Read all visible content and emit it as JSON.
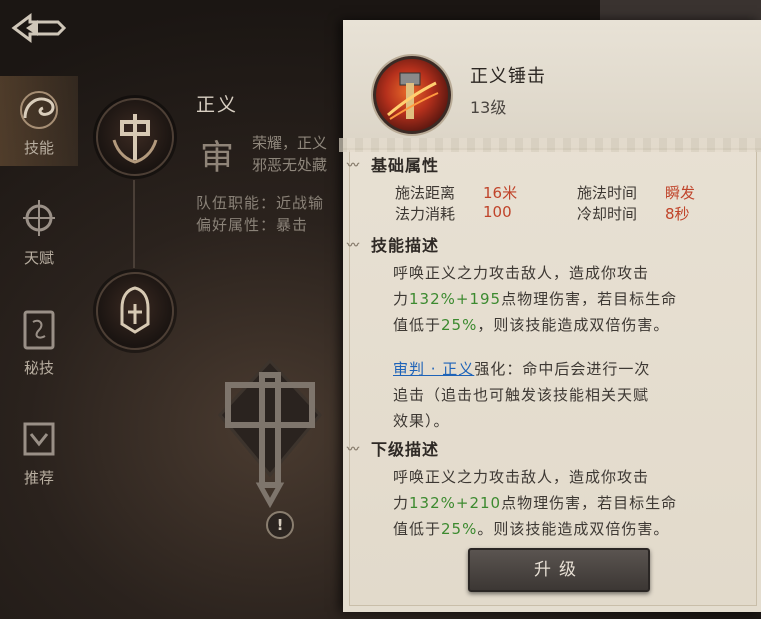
{
  "sidebar": {
    "items": [
      {
        "label": "技能",
        "icon": "skill-icon",
        "active": true
      },
      {
        "label": "天赋",
        "icon": "talent-icon",
        "active": false
      },
      {
        "label": "秘技",
        "icon": "secret-art-icon",
        "active": false
      },
      {
        "label": "推荐",
        "icon": "recommend-icon",
        "active": false
      }
    ]
  },
  "hero": {
    "name": "正义",
    "title_char": "审",
    "desc_line1": "荣耀，正义",
    "desc_line2": "邪恶无处藏",
    "role_line": "队伍职能：近战输",
    "pref_line": "偏好属性：暴击",
    "alert": "!"
  },
  "popup": {
    "skill_name": "正义锤击",
    "skill_level": "13级",
    "basic_title": "基础属性",
    "attrs": {
      "range_label": "施法距离",
      "range_value": "16米",
      "cast_label": "施法时间",
      "cast_value": "瞬发",
      "cost_label": "法力消耗",
      "cost_value": "100",
      "cd_label": "冷却时间",
      "cd_value": "8秒"
    },
    "desc_title": "技能描述",
    "desc": {
      "l1": "呼唤正义之力攻击敌人，造成你攻击",
      "l2_a": "力",
      "l2_b": "132%+195",
      "l2_c": "点物理伤害，若目标生命",
      "l3_a": "值低于",
      "l3_b": "25%",
      "l3_c": "，则该技能造成双倍伤害。"
    },
    "enhance": {
      "link": "审判 · 正义",
      "t1": "强化：命中后会进行一次",
      "t2": "追击（追击也可触发该技能相关天赋",
      "t3": "效果）。"
    },
    "next_title": "下级描述",
    "next": {
      "l1": "呼唤正义之力攻击敌人，造成你攻击",
      "l2_a": "力",
      "l2_b": "132%+210",
      "l2_c": "点物理伤害，若目标生命",
      "l3_a": "值低于",
      "l3_b": "25%",
      "l3_c": "。则该技能造成双倍伤害。"
    },
    "upgrade_label": "升级"
  }
}
